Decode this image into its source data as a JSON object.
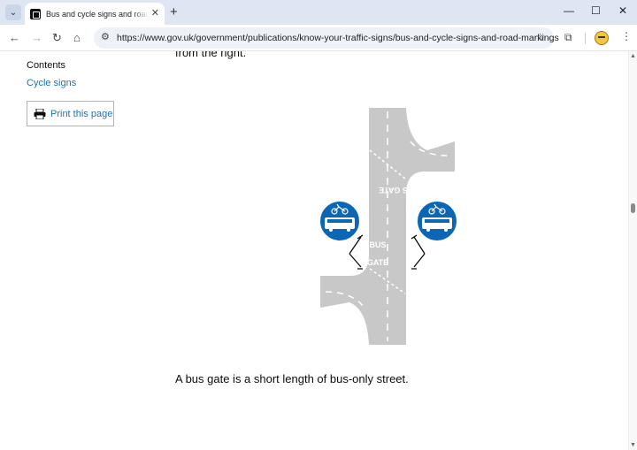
{
  "browser": {
    "tab_title": "Bus and cycle signs and road markings",
    "url": "https://www.gov.uk/government/publications/know-your-traffic-signs/bus-and-cycle-signs-and-road-markings"
  },
  "sidebar": {
    "contents_heading": "Contents",
    "cycle_link": "Cycle signs",
    "print_label": "Print this page"
  },
  "main": {
    "cut_text": "from the right.",
    "caption": "A bus gate is a short length of bus-only street.",
    "road_marking_top": "BUS GATE",
    "road_marking_bottom_1": "BUS",
    "road_marking_bottom_2": "GATE"
  },
  "colors": {
    "link": "#1d70b8",
    "road": "#c8c8c8",
    "sign_blue": "#0b66b5"
  }
}
